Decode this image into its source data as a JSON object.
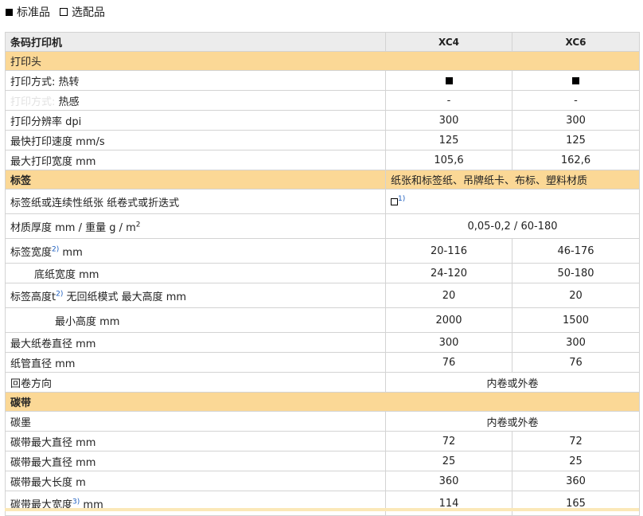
{
  "legend": {
    "standard": "标准品",
    "optional": "选配品"
  },
  "table": {
    "header": {
      "label": "条码打印机",
      "col1": "XC4",
      "col2": "XC6"
    },
    "section_print_head": "打印头",
    "print_method": {
      "label": "打印方式: 热转"
    },
    "thermal": {
      "ghost": "打印方式:",
      "label": "热感",
      "col1": "-",
      "col2": "-"
    },
    "resolution": {
      "label": "打印分辨率 dpi",
      "col1": "300",
      "col2": "300"
    },
    "max_speed": {
      "label": "最快打印速度 mm/s",
      "col1": "125",
      "col2": "125"
    },
    "max_width": {
      "label": "最大打印宽度 mm",
      "col1": "105,6",
      "col2": "162,6"
    },
    "section_label": {
      "label": "标签",
      "value": "纸张和标签纸、吊牌纸卡、布标、塑料材质"
    },
    "paper_type": {
      "label": "标签纸或连续性纸张 纸卷式或折迭式",
      "note": "1)"
    },
    "thickness": {
      "label": "材质厚度 mm / 重量 g / m",
      "exp": "2",
      "value": "0,05-0,2 / 60-180"
    },
    "label_width": {
      "label": "标签宽度",
      "note": "2)",
      "unit": "mm",
      "col1": "20-116",
      "col2": "46-176"
    },
    "liner_width": {
      "label": "底纸宽度 mm",
      "col1": "24-120",
      "col2": "50-180"
    },
    "label_height": {
      "label": "标签高度t",
      "note": "2)",
      "rest": "无回纸模式 最大高度 mm",
      "col1": "20",
      "col2": "20"
    },
    "min_height": {
      "label": "最小高度 mm",
      "col1": "2000",
      "col2": "1500"
    },
    "roll_diameter": {
      "label": "最大纸卷直径 mm",
      "col1": "300",
      "col2": "300"
    },
    "core_diameter": {
      "label": "纸管直径 mm",
      "col1": "76",
      "col2": "76"
    },
    "wind_direction": {
      "label": "回卷方向",
      "value": "内卷或外卷"
    },
    "section_ribbon": "碳带",
    "ink_side": {
      "label": "碳墨",
      "value": "内卷或外卷"
    },
    "ribbon_max_diameter": {
      "label": "碳带最大直径 mm",
      "col1": "72",
      "col2": "72"
    },
    "ribbon_core": {
      "label": "碳带最大直径 mm",
      "col1": "25",
      "col2": "25"
    },
    "ribbon_length": {
      "label": "碳带最大长度 m",
      "col1": "360",
      "col2": "360"
    },
    "ribbon_width": {
      "label": "碳带最大宽度",
      "note": "3)",
      "unit": "mm",
      "col1": "114",
      "col2": "165"
    }
  }
}
